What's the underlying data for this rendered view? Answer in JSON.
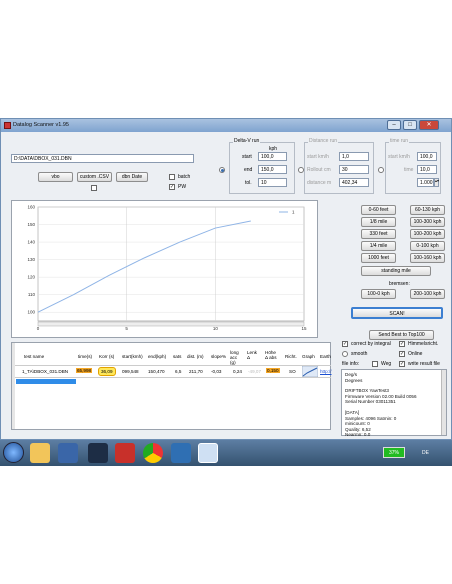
{
  "window": {
    "title": "Datalog Scanner v1.95"
  },
  "file": {
    "path": "D:\\DATA\\DBOX_031.DBN"
  },
  "buttons": {
    "vbo": "vbo",
    "custom_csv": "custom .CSV",
    "dbn_date": "dbn Date",
    "scan": "SCAN!",
    "send_best": "Send Best to Top100"
  },
  "checks": {
    "batch": "batch",
    "pw": "PW"
  },
  "delta_v": {
    "title": "Delta-V run",
    "unit": "kph",
    "start_label": "start",
    "start_value": "100,0",
    "end_label": "end",
    "end_value": "150,0",
    "tol_label": "tol.",
    "tol_value": "10"
  },
  "distance_run": {
    "title": "Distance run",
    "start_label": "start km/h",
    "start_value": "1,0",
    "rollout_label": "Rollout cm",
    "rollout_value": "30",
    "distance_label": "distance m",
    "distance_value": "402,34"
  },
  "time_run": {
    "title": "time run",
    "start_label": "start km/h",
    "start_value": "100,0",
    "time_label": "time",
    "time_value": "10,0",
    "spin_value": "1.000"
  },
  "presets": {
    "left": [
      "0-60 feet",
      "1/8 mile",
      "330 feet",
      "1/4 mile",
      "1000 feet"
    ],
    "right": [
      "60-130 kph",
      "100-300 kph",
      "100-200 kph",
      "0-100 kph",
      "100-160 kph"
    ],
    "standing_mile": "standing mile",
    "braking_label": "bremsen:",
    "braking": [
      "100-0 kph",
      "200-100 kph"
    ]
  },
  "chart_data": {
    "type": "line",
    "series": [
      {
        "name": "1",
        "x": [
          0,
          2,
          4,
          6,
          8,
          10,
          12
        ],
        "y": [
          100,
          110,
          121,
          131,
          140,
          148,
          152
        ]
      }
    ],
    "xlim": [
      0,
      15
    ],
    "ylim": [
      95,
      160
    ],
    "xticks": [
      "0",
      "5",
      "10",
      "15"
    ],
    "yticks": [
      "100",
      "110",
      "120",
      "130",
      "140",
      "150",
      "160"
    ],
    "title": "",
    "xlabel": "",
    "ylabel": "",
    "grid": true,
    "legend": "top-right",
    "line_color": "#8fb4e6"
  },
  "table": {
    "headers": [
      "test name",
      "time(s)",
      "Korr (s)",
      "start(kmh)",
      "end(kph)",
      "sats",
      "dist. (m)",
      "slope%",
      "long acc (g)",
      "Lenk Δ",
      "Höhe Δ abs",
      "Richt.",
      "Graph",
      "Earth"
    ],
    "rows": [
      {
        "test_name": "1_TA\\DBOX_031.DBN",
        "time": "65,998",
        "korr": "36,09",
        "start": "099,548",
        "end": "150,470",
        "sats": "6,5",
        "dist": "211,70",
        "slope": "-0,03",
        "acc": "0,24",
        "lenk": "-49,07",
        "hoehe": "0,150",
        "richt": "SO",
        "earth": "http://"
      }
    ]
  },
  "options": {
    "correct_integral": "correct by integral",
    "himmelsricht": "Himmelsricht.",
    "smooth": "smooth",
    "online": "Online",
    "file_info": "file info:",
    "weg": "Weg",
    "write_result": "write result file"
  },
  "info_lines": [
    "Deg/s",
    "Degrees",
    "",
    "DRIFTBOX YawTest3",
    "Firmware Version 02.00 Build 0056",
    "Serial Number 03011351",
    "",
    "[DATA]",
    "Samples: 4096  Satmin: 0",
    "minicount: 0",
    "Quality: 6,52",
    "Nearmn: 0.0"
  ],
  "taskbar": {
    "battery": "37%",
    "lang": "DE"
  }
}
